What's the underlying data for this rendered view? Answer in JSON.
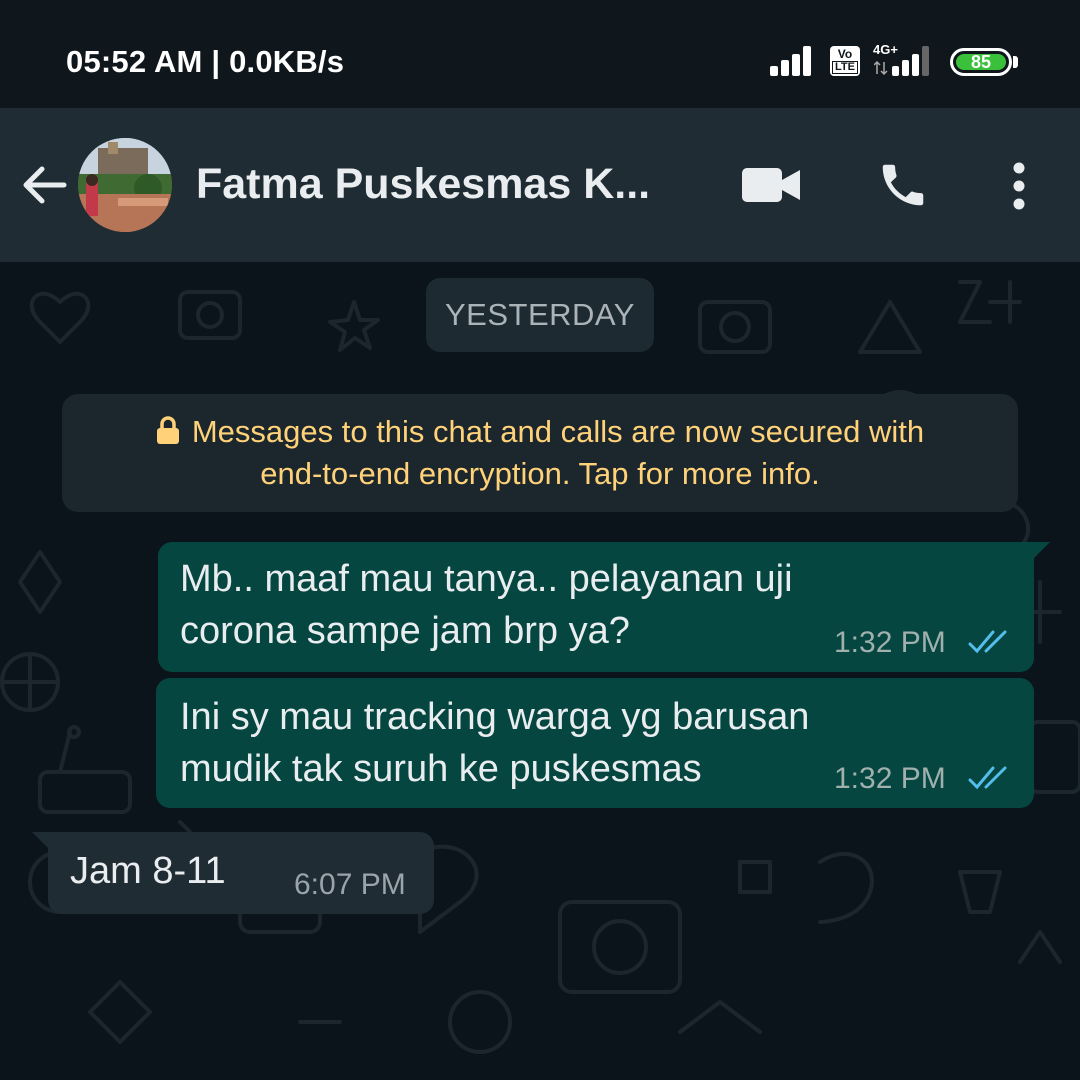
{
  "status_bar": {
    "time": "05:52 AM",
    "speed": "0.0KB/s",
    "volte_label_top": "Vo",
    "volte_label_bottom": "LTE",
    "network_type": "4G+",
    "battery": "85"
  },
  "header": {
    "contact_name": "Fatma Puskesmas K...",
    "icons": [
      "back-arrow-icon",
      "avatar",
      "video-call-icon",
      "voice-call-icon",
      "more-options-icon"
    ]
  },
  "chat": {
    "date_chip": "YESTERDAY",
    "encryption_notice": {
      "line1": "Messages to this chat and calls are now secured with",
      "line2": "end-to-end encryption. Tap for more info.",
      "icon": "lock-icon"
    },
    "messages": [
      {
        "direction": "outgoing",
        "lines": [
          "Mb.. maaf mau tanya.. pelayanan uji",
          "corona sampe jam brp ya?"
        ],
        "time": "1:32 PM",
        "status": "read"
      },
      {
        "direction": "outgoing",
        "lines": [
          "Ini sy mau tracking warga yg barusan",
          "mudik tak suruh ke puskesmas"
        ],
        "time": "1:32 PM",
        "status": "read"
      },
      {
        "direction": "incoming",
        "lines": [
          "Jam 8-11"
        ],
        "time": "6:07 PM"
      }
    ]
  },
  "colors": {
    "header_bg": "#1f2c34",
    "outgoing_bubble": "#054640",
    "incoming_bubble": "#1f2c34",
    "encryption_text": "#ffd279",
    "read_tick": "#53bdeb"
  }
}
